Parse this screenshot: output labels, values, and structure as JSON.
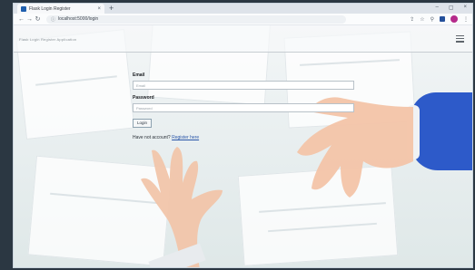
{
  "browser": {
    "tab_title": "Flask Login Register",
    "tab_close": "×",
    "new_tab": "+",
    "window_controls": [
      "–",
      "▢",
      "×"
    ],
    "url_protocol_icon": "info-icon",
    "url": "localhost:5000/login",
    "nav_icons": [
      "back-icon",
      "forward-icon",
      "reload-icon"
    ],
    "toolbar_icons": [
      "share-icon",
      "star-icon",
      "extension-icon",
      "profile-avatar"
    ]
  },
  "app": {
    "brand": "Flask Login Register Application",
    "menu_icon": "hamburger-menu-icon"
  },
  "form": {
    "email_label": "Email",
    "email_placeholder": "Email",
    "password_label": "Password",
    "password_placeholder": "Password",
    "login_button": "Login",
    "register_prompt": "Have not account? ",
    "register_link": "Register here"
  },
  "colors": {
    "sleeve": "#2d5ac9",
    "profile": "#b52a8b",
    "link": "#2a56a8"
  }
}
